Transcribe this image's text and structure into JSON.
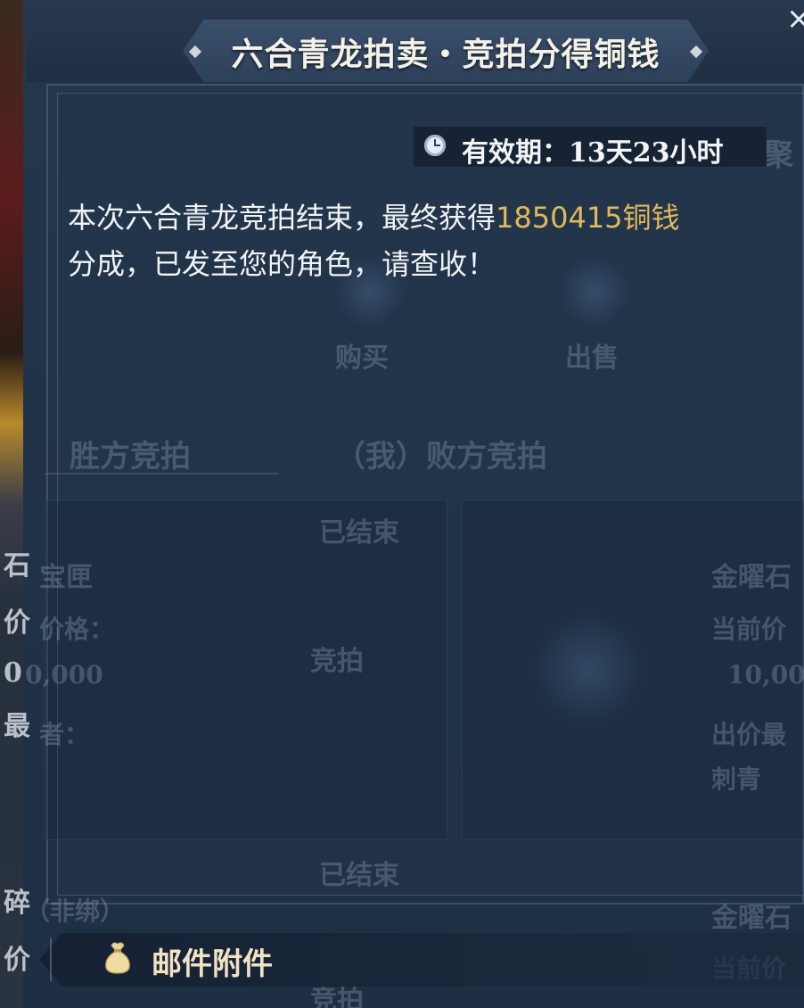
{
  "title": "六合青龙拍卖・竞拍分得铜钱",
  "close_symbol": "×",
  "validity": {
    "label": "有效期：",
    "value": "13天23小时"
  },
  "message": {
    "prefix": "本次六合青龙竞拍结束，最终获得",
    "amount": "1850415铜钱",
    "suffix": "分成，已发至您的角色，请查收！"
  },
  "attachment": {
    "label": "邮件附件",
    "icon": "money-bag-icon"
  },
  "background_ui": {
    "right_tab": "聚",
    "buy": "购买",
    "sell": "出售",
    "tab_winner": "胜方竞拍",
    "tab_loser": "（我）败方竞拍",
    "status_ended_1": "已结束",
    "status_ended_2": "已结束",
    "item_left": "宝匣",
    "item_right": "金曜石",
    "item_right_2": "金曜石",
    "price_label_left": "价格：",
    "price_label_right": "当前价",
    "price_label_right_2": "当前价",
    "price_left": "0,000",
    "price_right": "10,00",
    "bidder_label_left": "者：",
    "bidder_label_right": "出价最",
    "bidder_right": "刺青",
    "bid_button": "竞拍",
    "bid_button_2": "竞拍",
    "item_left_2": "（非绑）",
    "left_frag_1": "石",
    "left_frag_2": "价",
    "left_frag_3": "0",
    "left_frag_4": "最",
    "left_frag_5": "碎",
    "left_frag_6": "价"
  },
  "colors": {
    "amount": "#e2b95a",
    "panel": "#22344a",
    "text": "#f1f3f5"
  }
}
